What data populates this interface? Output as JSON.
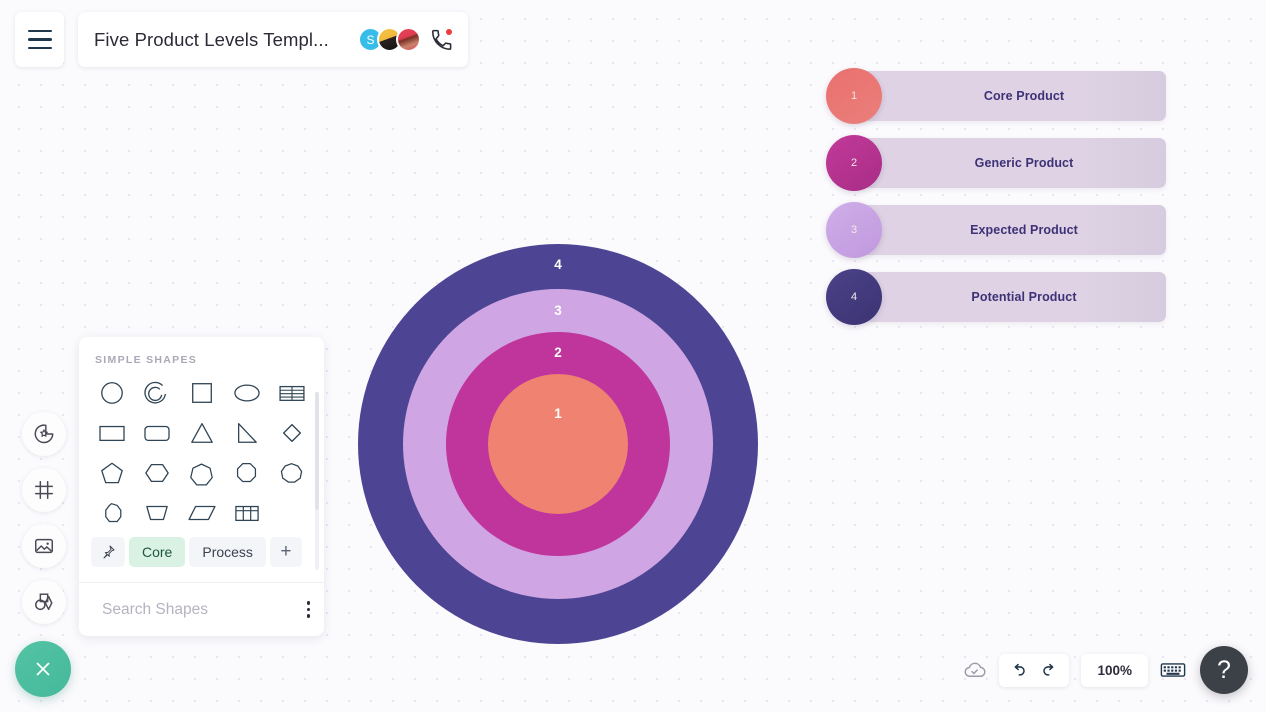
{
  "app": {
    "document_title": "Five Product Levels Templ...",
    "menu_icon": "hamburger-menu-icon"
  },
  "collaborators": [
    {
      "initial": "S",
      "type": "initial",
      "color": "#38bdea"
    },
    {
      "initial": "",
      "type": "photo",
      "color": "#f4c34a"
    },
    {
      "initial": "",
      "type": "photo",
      "color": "#e8455a"
    }
  ],
  "call_icon": "phone-call-icon",
  "left_toolbar": [
    {
      "name": "sticker-shape-icon",
      "label": "Shapes & Stickers"
    },
    {
      "name": "frame-icon",
      "label": "Frames"
    },
    {
      "name": "image-icon",
      "label": "Images"
    },
    {
      "name": "shape-library-icon",
      "label": "Shape Library"
    }
  ],
  "shapes_panel": {
    "header": "SIMPLE SHAPES",
    "shapes": [
      {
        "name": "circle",
        "label": "Circle"
      },
      {
        "name": "arc",
        "label": "Arc"
      },
      {
        "name": "square",
        "label": "Square"
      },
      {
        "name": "ellipse",
        "label": "Ellipse"
      },
      {
        "name": "table-lines",
        "label": "Table"
      },
      {
        "name": "rectangle",
        "label": "Rectangle"
      },
      {
        "name": "rounded-rectangle",
        "label": "Rounded Rectangle"
      },
      {
        "name": "triangle",
        "label": "Triangle"
      },
      {
        "name": "right-triangle",
        "label": "Right Triangle"
      },
      {
        "name": "diamond",
        "label": "Diamond"
      },
      {
        "name": "pentagon",
        "label": "Pentagon"
      },
      {
        "name": "hexagon",
        "label": "Hexagon"
      },
      {
        "name": "heptagon",
        "label": "Heptagon"
      },
      {
        "name": "octagon",
        "label": "Octagon"
      },
      {
        "name": "nonagon",
        "label": "Nonagon"
      },
      {
        "name": "decagon",
        "label": "Decagon"
      },
      {
        "name": "trapezoid",
        "label": "Trapezoid"
      },
      {
        "name": "parallelogram",
        "label": "Parallelogram"
      },
      {
        "name": "table-grid",
        "label": "Table Grid"
      }
    ],
    "tabs": [
      {
        "label": "Core",
        "active": true
      },
      {
        "label": "Process",
        "active": false
      }
    ],
    "pin_icon": "pin-icon",
    "add_tab_label": "+",
    "search_placeholder": "Search Shapes",
    "search_value": "",
    "search_icon": "search-icon",
    "more_icon": "kebab-menu-icon"
  },
  "chart_data": {
    "type": "pie",
    "title": "Five Product Levels",
    "layout": "concentric-circles",
    "rings": [
      {
        "number": "4",
        "label": "Potential Product",
        "color": "#4d4494",
        "diameter": 400
      },
      {
        "number": "3",
        "label": "Expected Product",
        "color": "#cfa6e3",
        "diameter": 310
      },
      {
        "number": "2",
        "label": "Generic Product",
        "color": "#c0359c",
        "diameter": 224
      },
      {
        "number": "1",
        "label": "Core Product",
        "color": "#ef8270",
        "diameter": 140
      }
    ],
    "legend_position": "right"
  },
  "legend": {
    "items": [
      {
        "number": "1",
        "label": "Core Product",
        "color": "#e8716f"
      },
      {
        "number": "2",
        "label": "Generic Product",
        "color": "#bd3694"
      },
      {
        "number": "3",
        "label": "Expected Product",
        "color": "#c9a6e2"
      },
      {
        "number": "4",
        "label": "Potential Product",
        "color": "#443c80"
      }
    ]
  },
  "bottom_bar": {
    "close_icon": "close-x-icon",
    "cloud_icon": "cloud-saved-icon",
    "undo_icon": "undo-arrow-icon",
    "redo_icon": "redo-arrow-icon",
    "zoom_level": "100%",
    "keyboard_icon": "keyboard-icon",
    "help_label": "?"
  }
}
